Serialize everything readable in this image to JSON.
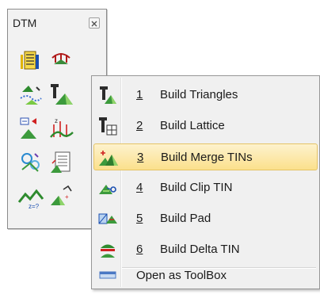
{
  "toolbox": {
    "title": "DTM",
    "close_icon": "close-icon",
    "tools": [
      {
        "name": "tool-properties-icon"
      },
      {
        "name": "tool-tin-explorer-icon"
      },
      {
        "name": "tool-build-icon"
      },
      {
        "name": "tool-build-triangles-icon"
      },
      {
        "name": "tool-extract-icon"
      },
      {
        "name": "tool-profile-icon"
      },
      {
        "name": "tool-analyze-icon"
      },
      {
        "name": "tool-report-icon"
      },
      {
        "name": "tool-label-icon"
      },
      {
        "name": "tool-volume-icon"
      }
    ]
  },
  "menu": {
    "items": [
      {
        "number": "1",
        "label": "Build Triangles",
        "icon": "build-triangles-icon"
      },
      {
        "number": "2",
        "label": "Build Lattice",
        "icon": "build-lattice-icon"
      },
      {
        "number": "3",
        "label": "Build Merge TINs",
        "icon": "build-merge-tins-icon",
        "highlighted": true
      },
      {
        "number": "4",
        "label": "Build Clip TIN",
        "icon": "build-clip-tin-icon"
      },
      {
        "number": "5",
        "label": "Build Pad",
        "icon": "build-pad-icon"
      },
      {
        "number": "6",
        "label": "Build Delta TIN",
        "icon": "build-delta-tin-icon"
      }
    ],
    "open_as_toolbox_label": "Open as ToolBox",
    "highlight_color": "#fbe08c"
  }
}
